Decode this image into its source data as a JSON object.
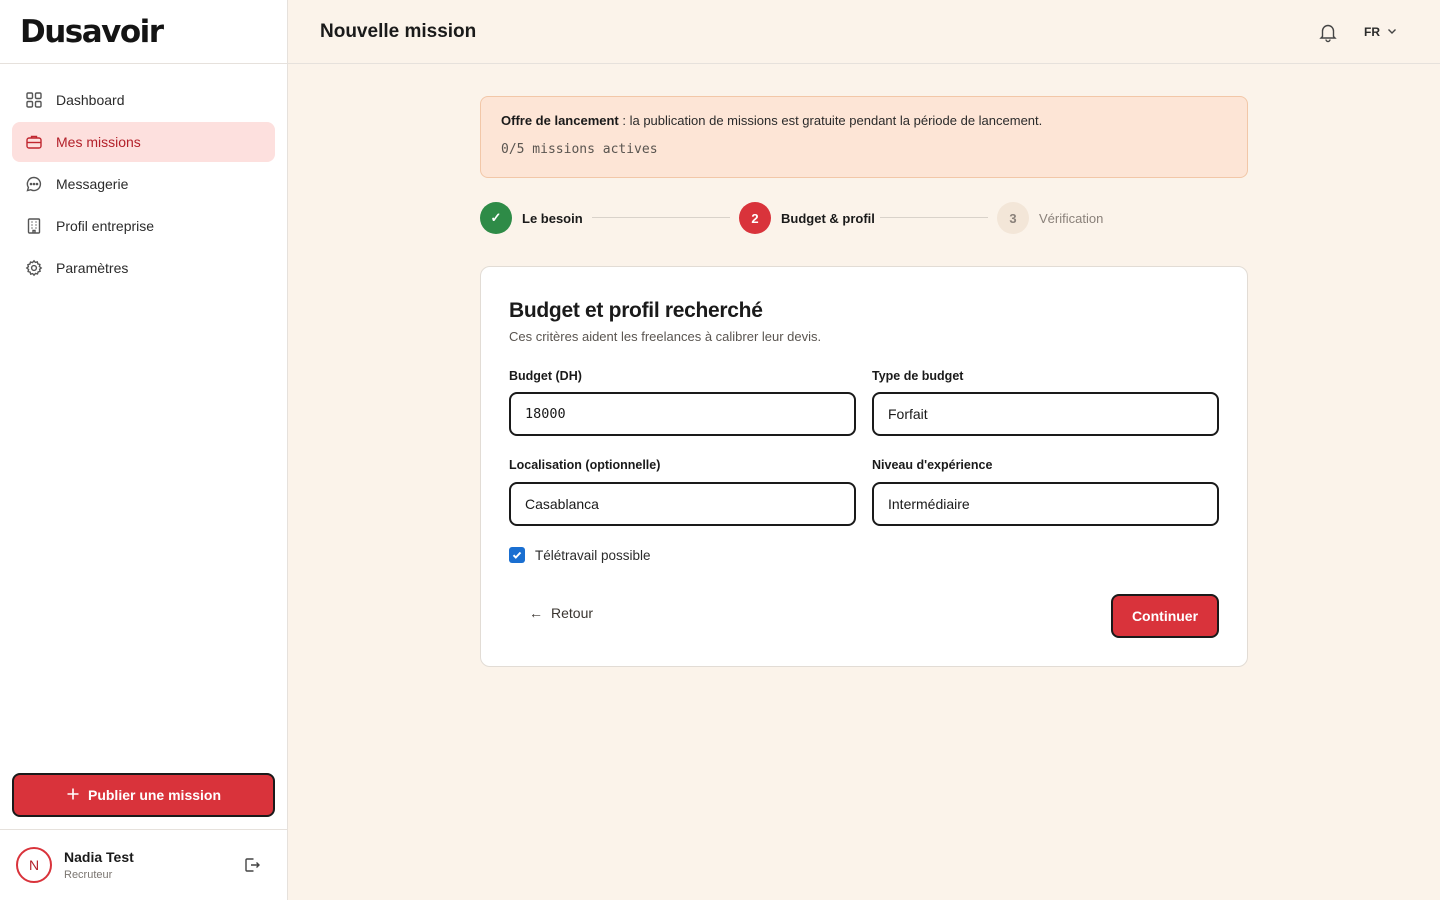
{
  "brand": {
    "logo_text": "Dusavoir"
  },
  "sidebar": {
    "items": [
      {
        "label": "Dashboard",
        "icon": "grid-icon",
        "active": false
      },
      {
        "label": "Mes missions",
        "icon": "briefcase-icon",
        "active": true
      },
      {
        "label": "Messagerie",
        "icon": "chat-icon",
        "active": false
      },
      {
        "label": "Profil entreprise",
        "icon": "building-icon",
        "active": false
      },
      {
        "label": "Paramètres",
        "icon": "gear-icon",
        "active": false
      }
    ],
    "publish_label": "Publier une mission"
  },
  "user": {
    "initial": "N",
    "name": "Nadia Test",
    "role": "Recruteur"
  },
  "header": {
    "title": "Nouvelle mission",
    "language": "FR"
  },
  "banner": {
    "title": "Offre de lancement",
    "text": " : la publication de missions est gratuite pendant la période de lancement.",
    "count": "0/5 missions actives"
  },
  "stepper": [
    {
      "number": "✓",
      "label": "Le besoin",
      "state": "done"
    },
    {
      "number": "2",
      "label": "Budget & profil",
      "state": "current"
    },
    {
      "number": "3",
      "label": "Vérification",
      "state": "upcoming"
    }
  ],
  "form": {
    "title": "Budget et profil recherché",
    "subtitle": "Ces critères aident les freelances à calibrer leur devis.",
    "budget_label": "Budget (DH)",
    "budget_value": "18000",
    "budget_type_label": "Type de budget",
    "budget_type_value": "Forfait",
    "location_label": "Localisation (optionnelle)",
    "location_value": "Casablanca",
    "experience_label": "Niveau d'expérience",
    "experience_value": "Intermédiaire",
    "remote_label": "Télétravail possible",
    "remote_checked": true,
    "back_label": "Retour",
    "continue_label": "Continuer"
  },
  "colors": {
    "accent": "#d9333b",
    "success": "#2e8b47",
    "background": "#fbf3ea",
    "banner_bg": "#fde5d6",
    "checkbox": "#1a6fd1"
  }
}
